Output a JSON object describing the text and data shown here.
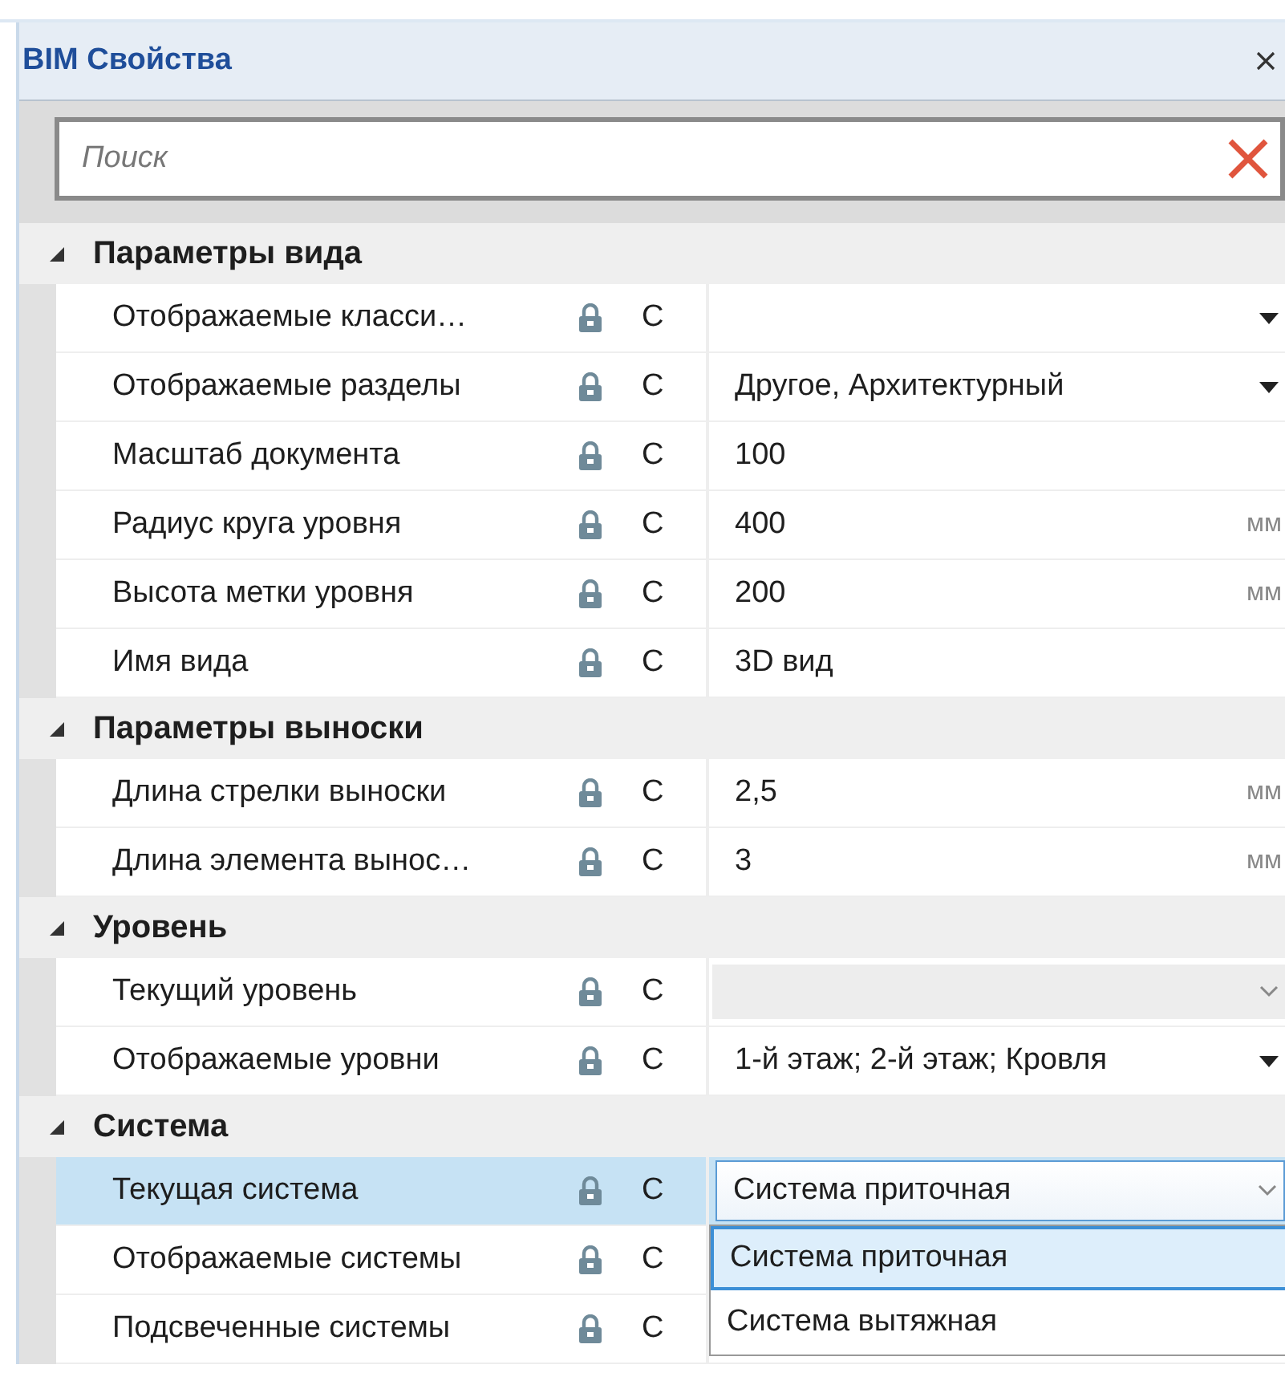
{
  "window": {
    "title": "BIM Свойства"
  },
  "search": {
    "placeholder": "Поиск"
  },
  "sections": [
    {
      "title": "Параметры вида",
      "expanded": true,
      "rows": [
        {
          "name": "Отображаемые класси…",
          "scope": "С",
          "kind": "dropdown",
          "selected": false
        },
        {
          "name": "Отображаемые разделы",
          "scope": "С",
          "kind": "dropdown",
          "value": "Другое, Архитектурный",
          "selected": false
        },
        {
          "name": "Масштаб документа",
          "scope": "С",
          "kind": "text",
          "value": "100",
          "selected": false
        },
        {
          "name": "Радиус круга уровня",
          "scope": "С",
          "kind": "text",
          "value": "400",
          "unit": "мм",
          "selected": false
        },
        {
          "name": "Высота метки уровня",
          "scope": "С",
          "kind": "text",
          "value": "200",
          "unit": "мм",
          "selected": false
        },
        {
          "name": "Имя вида",
          "scope": "С",
          "kind": "text",
          "value": "3D вид",
          "selected": false
        }
      ]
    },
    {
      "title": "Параметры выноски",
      "expanded": true,
      "rows": [
        {
          "name": "Длина стрелки выноски",
          "scope": "С",
          "kind": "text",
          "value": "2,5",
          "unit": "мм",
          "selected": false
        },
        {
          "name": "Длина элемента вынос…",
          "scope": "С",
          "kind": "text",
          "value": "3",
          "unit": "мм",
          "selected": false
        }
      ]
    },
    {
      "title": "Уровень",
      "expanded": true,
      "rows": [
        {
          "name": "Текущий уровень",
          "scope": "С",
          "kind": "disabled-dropdown",
          "selected": false
        },
        {
          "name": "Отображаемые уровни",
          "scope": "С",
          "kind": "dropdown",
          "value": "1-й этаж; 2-й этаж; Кровля",
          "selected": false
        }
      ]
    },
    {
      "title": "Система",
      "expanded": true,
      "rows": [
        {
          "name": "Текущая система",
          "scope": "С",
          "kind": "combo",
          "value": "Система приточная",
          "selected": true,
          "options": [
            {
              "label": "Система приточная",
              "selected": true
            },
            {
              "label": "Система вытяжная",
              "selected": false
            }
          ]
        },
        {
          "name": "Отображаемые системы",
          "scope": "С",
          "kind": "text",
          "selected": false
        },
        {
          "name": "Подсвеченные системы",
          "scope": "С",
          "kind": "text",
          "selected": false
        }
      ]
    }
  ]
}
